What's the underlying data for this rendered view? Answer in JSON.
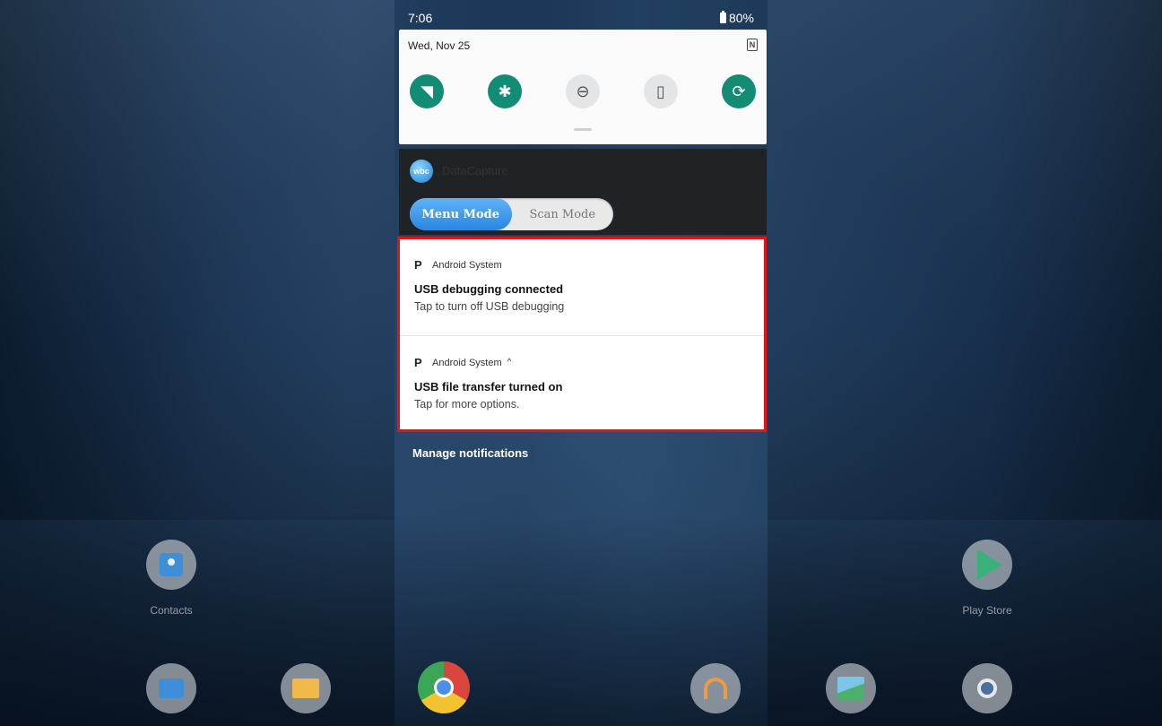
{
  "status_bar": {
    "time": "7:06",
    "battery": "80%"
  },
  "quick_settings": {
    "date": "Wed, Nov 25",
    "nfc_glyph": "N",
    "tiles": [
      {
        "name": "wifi",
        "icon": "wifi-icon",
        "glyph": "◥",
        "state": "on"
      },
      {
        "name": "bluetooth",
        "icon": "bluetooth-icon",
        "glyph": "✱",
        "state": "on"
      },
      {
        "name": "do-not-disturb",
        "icon": "dnd-icon",
        "glyph": "⊖",
        "state": "off"
      },
      {
        "name": "flashlight",
        "icon": "flashlight-icon",
        "glyph": "▯",
        "state": "off"
      },
      {
        "name": "auto-rotate",
        "icon": "rotate-icon",
        "glyph": "⟳",
        "state": "on"
      }
    ]
  },
  "datacapture": {
    "app_name": "DataCapture",
    "icon_text": "wbc",
    "modes": {
      "active": "Menu Mode",
      "inactive": "Scan Mode"
    }
  },
  "notifications": [
    {
      "app": "Android System",
      "app_glyph": "P",
      "title": "USB debugging connected",
      "text": "Tap to turn off USB debugging"
    },
    {
      "app": "Android System",
      "app_glyph": "P",
      "expand_glyph": "^",
      "title": "USB file transfer turned on",
      "text": "Tap for more options."
    }
  ],
  "manage_label": "Manage notifications",
  "home": {
    "contacts_label": "Contacts",
    "play_store_label": "Play Store"
  },
  "colors": {
    "accent": "#128c74",
    "highlight": "#e1141b",
    "toggle_active": "#2a86df"
  }
}
